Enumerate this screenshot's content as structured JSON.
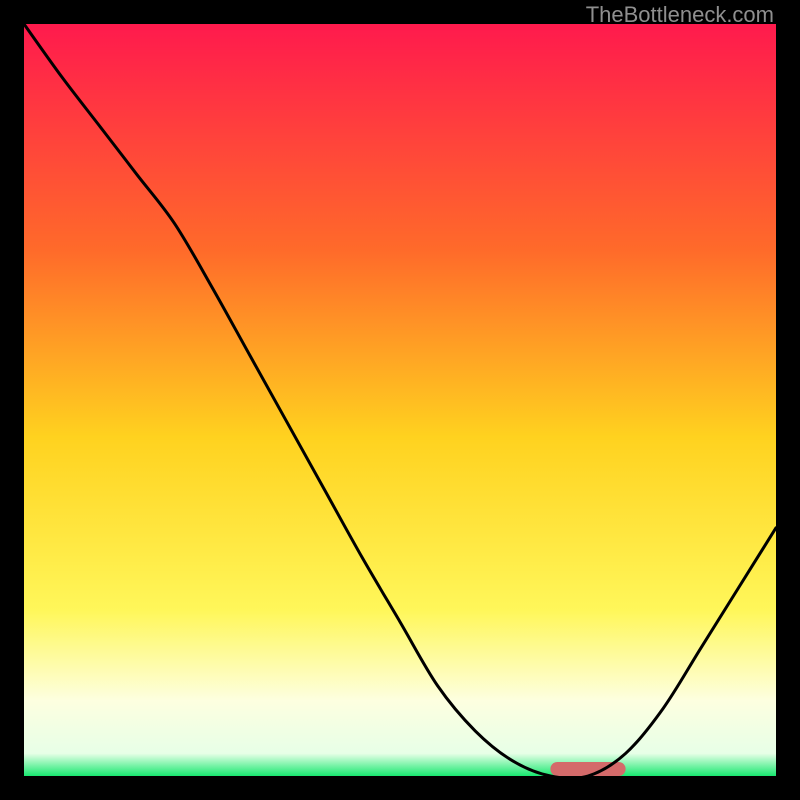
{
  "watermark": "TheBottleneck.com",
  "chart_data": {
    "type": "line",
    "title": "",
    "xlabel": "",
    "ylabel": "",
    "xlim": [
      0,
      100
    ],
    "ylim": [
      0,
      100
    ],
    "grid": false,
    "legend": false,
    "series": [
      {
        "name": "curve",
        "x": [
          0,
          5,
          10,
          15,
          20,
          25,
          30,
          35,
          40,
          45,
          50,
          55,
          60,
          65,
          70,
          75,
          80,
          85,
          90,
          95,
          100
        ],
        "values": [
          100,
          93,
          86.5,
          80,
          73.5,
          65,
          56,
          47,
          38,
          29,
          20.5,
          12,
          6,
          2,
          0,
          0,
          3,
          9,
          17,
          25,
          33
        ]
      }
    ],
    "marker": {
      "name": "highlight-bar",
      "x_start": 70,
      "x_end": 80,
      "y": 0,
      "color": "#d46a6a"
    },
    "background_gradient": {
      "stops": [
        {
          "offset": 0.0,
          "color": "#ff1a4d"
        },
        {
          "offset": 0.3,
          "color": "#ff6a2a"
        },
        {
          "offset": 0.55,
          "color": "#ffd21f"
        },
        {
          "offset": 0.78,
          "color": "#fff75a"
        },
        {
          "offset": 0.9,
          "color": "#fdffe0"
        },
        {
          "offset": 0.97,
          "color": "#e7ffe7"
        },
        {
          "offset": 1.0,
          "color": "#18e870"
        }
      ]
    }
  }
}
